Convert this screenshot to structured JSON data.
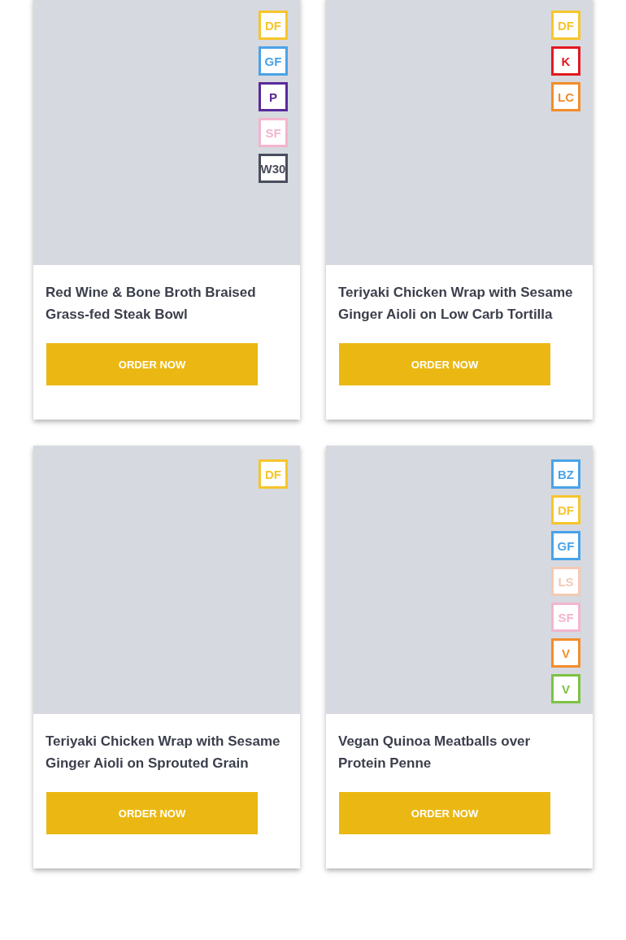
{
  "meals": [
    {
      "title": "Red Wine & Bone Broth Braised Grass-fed Steak Bowl",
      "button": "ORDER NOW",
      "badges": [
        {
          "label": "DF",
          "color": "#f7c52b"
        },
        {
          "label": "GF",
          "color": "#4aa3e8"
        },
        {
          "label": "P",
          "color": "#5b2a9a"
        },
        {
          "label": "SF",
          "color": "#f3b4cf"
        },
        {
          "label": "W30",
          "color": "#4a4d5c"
        }
      ]
    },
    {
      "title": "Teriyaki Chicken Wrap with Sesame Ginger Aioli on Low Carb Tortilla",
      "button": "ORDER NOW",
      "badges": [
        {
          "label": "DF",
          "color": "#f7c52b"
        },
        {
          "label": "K",
          "color": "#e3181f"
        },
        {
          "label": "LC",
          "color": "#f28d2a"
        }
      ]
    },
    {
      "title": "Teriyaki Chicken Wrap with Sesame Ginger Aioli on Sprouted Grain",
      "button": "ORDER NOW",
      "badges": [
        {
          "label": "DF",
          "color": "#f7c52b"
        }
      ]
    },
    {
      "title": "Vegan Quinoa Meatballs over Protein Penne",
      "button": "ORDER NOW",
      "badges": [
        {
          "label": "BZ",
          "color": "#4aa3e8"
        },
        {
          "label": "DF",
          "color": "#f7c52b"
        },
        {
          "label": "GF",
          "color": "#4aa3e8"
        },
        {
          "label": "LS",
          "color": "#f3c9b4"
        },
        {
          "label": "SF",
          "color": "#f3b4cf"
        },
        {
          "label": "V",
          "color": "#f28d2a"
        },
        {
          "label": "V",
          "color": "#7cc243"
        }
      ]
    }
  ]
}
